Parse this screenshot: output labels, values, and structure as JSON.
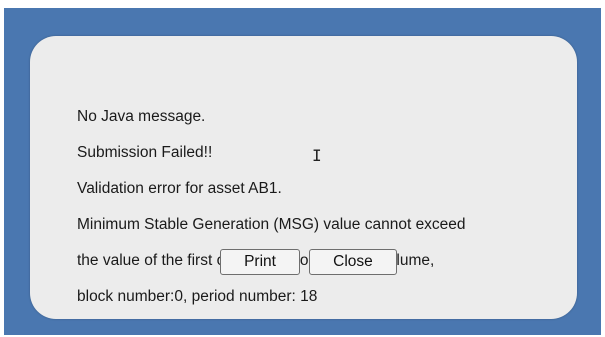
{
  "dialog": {
    "message_lines": [
      "No Java message.",
      "Submission Failed!!",
      "Validation error for asset AB1.",
      "Minimum Stable Generation (MSG) value cannot exceed",
      "the value of the first offer block containing a volume,",
      "block number:0, period number: 18"
    ]
  },
  "buttons": {
    "print_label": "Print",
    "close_label": "Close"
  },
  "colors": {
    "frame_background": "#4a77b0",
    "dialog_background": "#ececec"
  },
  "icons": {
    "cursor": "text-cursor-icon"
  }
}
